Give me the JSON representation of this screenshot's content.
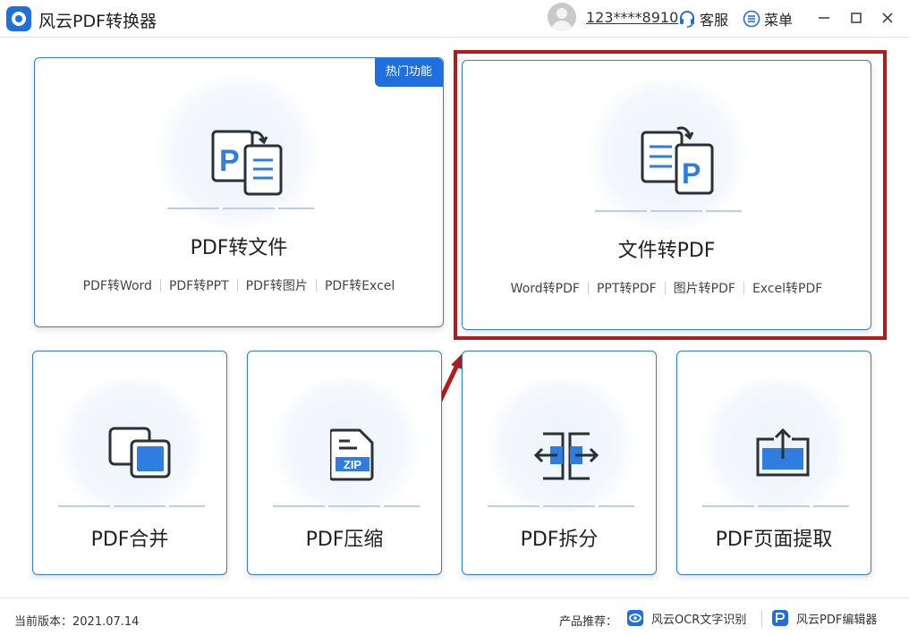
{
  "app": {
    "title": "风云PDF转换器"
  },
  "user": {
    "phone": "123****8910"
  },
  "toolbar": {
    "service_label": "客服",
    "menu_label": "菜单"
  },
  "main_features": [
    {
      "title": "PDF转文件",
      "badge": "热门功能",
      "links": [
        "PDF转Word",
        "PDF转PPT",
        "PDF转图片",
        "PDF转Excel"
      ]
    },
    {
      "title": "文件转PDF",
      "links": [
        "Word转PDF",
        "PPT转PDF",
        "图片转PDF",
        "Excel转PDF"
      ]
    }
  ],
  "tools": [
    {
      "title": "PDF合并"
    },
    {
      "title": "PDF压缩",
      "icon_text": "ZIP"
    },
    {
      "title": "PDF拆分"
    },
    {
      "title": "PDF页面提取"
    }
  ],
  "footer": {
    "version_label": "当前版本：",
    "version_value": "2021.07.14",
    "recommend_label": "产品推荐：",
    "products": [
      "风云OCR文字识别",
      "风云PDF编辑器"
    ]
  },
  "colors": {
    "accent": "#1f6fde",
    "border": "#2f7de1",
    "highlight": "#b01c1c",
    "icon_dark": "#2b2f36"
  }
}
